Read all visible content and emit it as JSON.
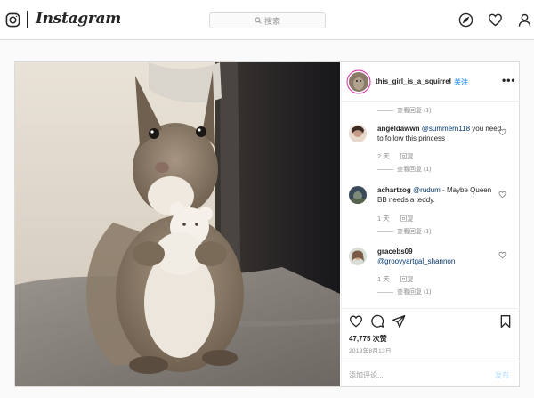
{
  "nav": {
    "logo_text": "Instagram",
    "search_placeholder": "搜索",
    "icons": [
      "instagram-glyph-icon",
      "search-icon",
      "compass-icon",
      "heart-icon",
      "person-icon"
    ]
  },
  "post": {
    "owner": "this_girl_is_a_squirrel",
    "separator": "•",
    "follow_label": "关注",
    "more_label": "•••",
    "image_subject": "squirrel holding a small white teddy bear",
    "top_replies": "查看回复 (1)",
    "comments": [
      {
        "user": "angeldawwn",
        "mention": "@summern118",
        "text": " you need to follow this princess",
        "age": "2 天",
        "reply_label": "回复",
        "replies": "查看回复 (1)"
      },
      {
        "user": "achartzog",
        "mention": "@rudum",
        "text": " - Maybe Queen BB needs a teddy.",
        "age": "1 天",
        "reply_label": "回复",
        "replies": "查看回复 (1)"
      },
      {
        "user": "gracebs09",
        "mention": "@groovyartgal_shannon",
        "text": "",
        "age": "1 天",
        "reply_label": "回复",
        "replies": "查看回复 (1)"
      }
    ],
    "likes": "47,775 次赞",
    "date": "2019年8月13日",
    "comment_placeholder": "添加评论...",
    "post_label": "发布",
    "colors": {
      "link": "#3897f0",
      "post_disabled": "#b3dbff",
      "mention": "#003569"
    }
  }
}
